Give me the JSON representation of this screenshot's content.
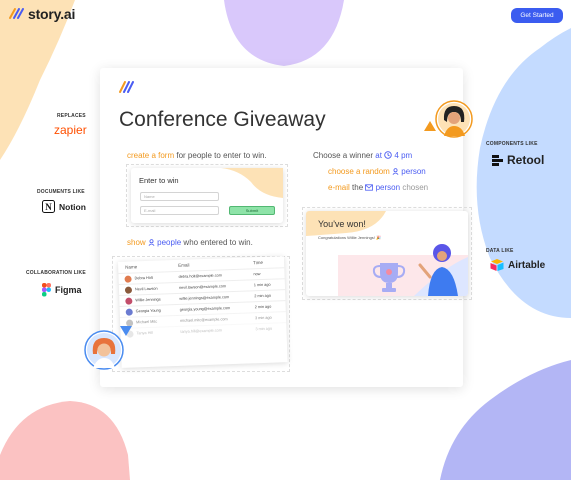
{
  "header": {
    "logo_text": "story.ai",
    "cta_label": "Get Started"
  },
  "sidebar_left": [
    {
      "caption": "REPLACES",
      "brand": "zapier"
    },
    {
      "caption": "DOCUMENTS LIKE",
      "brand": "Notion"
    },
    {
      "caption": "COLLABORATION LIKE",
      "brand": "Figma"
    }
  ],
  "sidebar_right": [
    {
      "caption": "COMPONENTS LIKE",
      "brand": "Retool"
    },
    {
      "caption": "DATA LIKE",
      "brand": "Airtable"
    }
  ],
  "card": {
    "title": "Conference Giveaway",
    "step1": {
      "link": "create a form",
      "rest": "for people to enter to win."
    },
    "form": {
      "title": "Enter to win",
      "name_placeholder": "Name",
      "email_placeholder": "E-mail",
      "submit_label": "Submit"
    },
    "step2": {
      "show": "show",
      "people": "people",
      "rest": "who entered to win."
    },
    "table": {
      "headers": [
        "Name",
        "Email",
        "Time"
      ],
      "rows": [
        {
          "name": "Debra Holt",
          "email": "debra.holt@example.com",
          "time": "now"
        },
        {
          "name": "Nevil Lawson",
          "email": "nevil.lawson@example.com",
          "time": "1 min ago"
        },
        {
          "name": "Willie Jennings",
          "email": "willie.jennings@example.com",
          "time": "2 min ago"
        },
        {
          "name": "Georgia Young",
          "email": "georgia.young@example.com",
          "time": "2 min ago"
        },
        {
          "name": "Michael Mitc",
          "email": "michael.mitc@example.com",
          "time": "3 min ago"
        },
        {
          "name": "Tanya Hill",
          "email": "tanya.hill@example.com",
          "time": "3 min ago"
        }
      ]
    },
    "step3": {
      "line1_a": "Choose a winner",
      "line1_at": "at",
      "line1_time": "4 pm",
      "line2_a": "choose a random",
      "line2_b": "person",
      "line3_a": "e-mail",
      "line3_the": "the",
      "line3_person": "person",
      "line3_chosen": "chosen"
    },
    "won": {
      "title": "You've won!",
      "subtitle": "Congratulations Willie Jennings! 🎉"
    }
  },
  "colors": {
    "accent_blue": "#3b5cf0",
    "accent_orange": "#f39a1f",
    "blob_peach": "#fde2b6",
    "blob_lavender": "#d9c8fb",
    "blob_lightblue": "#c4dbff",
    "blob_pink": "#fbc2c2"
  }
}
